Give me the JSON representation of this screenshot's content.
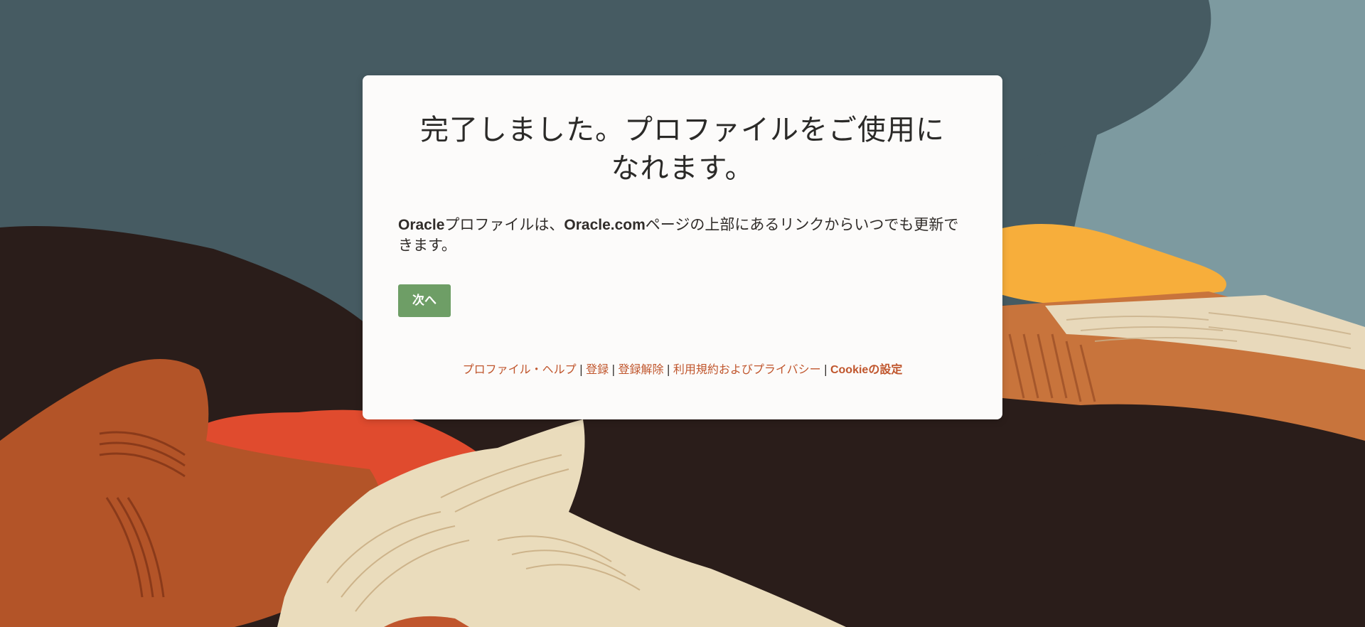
{
  "card": {
    "title_line1": "完了しました。プロファイルをご使用に",
    "title_line2": "なれます。",
    "body_brand1": "Oracle",
    "body_text1": "プロファイルは、",
    "body_brand2": "Oracle.com",
    "body_text2": "ページの上部にあるリンクからいつでも更新できます。",
    "next_button_label": "次へ"
  },
  "footer": {
    "links": [
      {
        "label": "プロファイル・ヘルプ"
      },
      {
        "label": "登録"
      },
      {
        "label": "登録解除"
      },
      {
        "label": "利用規約およびプライバシー"
      },
      {
        "label": "Cookieの設定"
      }
    ],
    "separator": "|"
  },
  "colors": {
    "button": "#6e9e66",
    "link": "#c0562d",
    "card_bg": "#fcfbfa"
  }
}
